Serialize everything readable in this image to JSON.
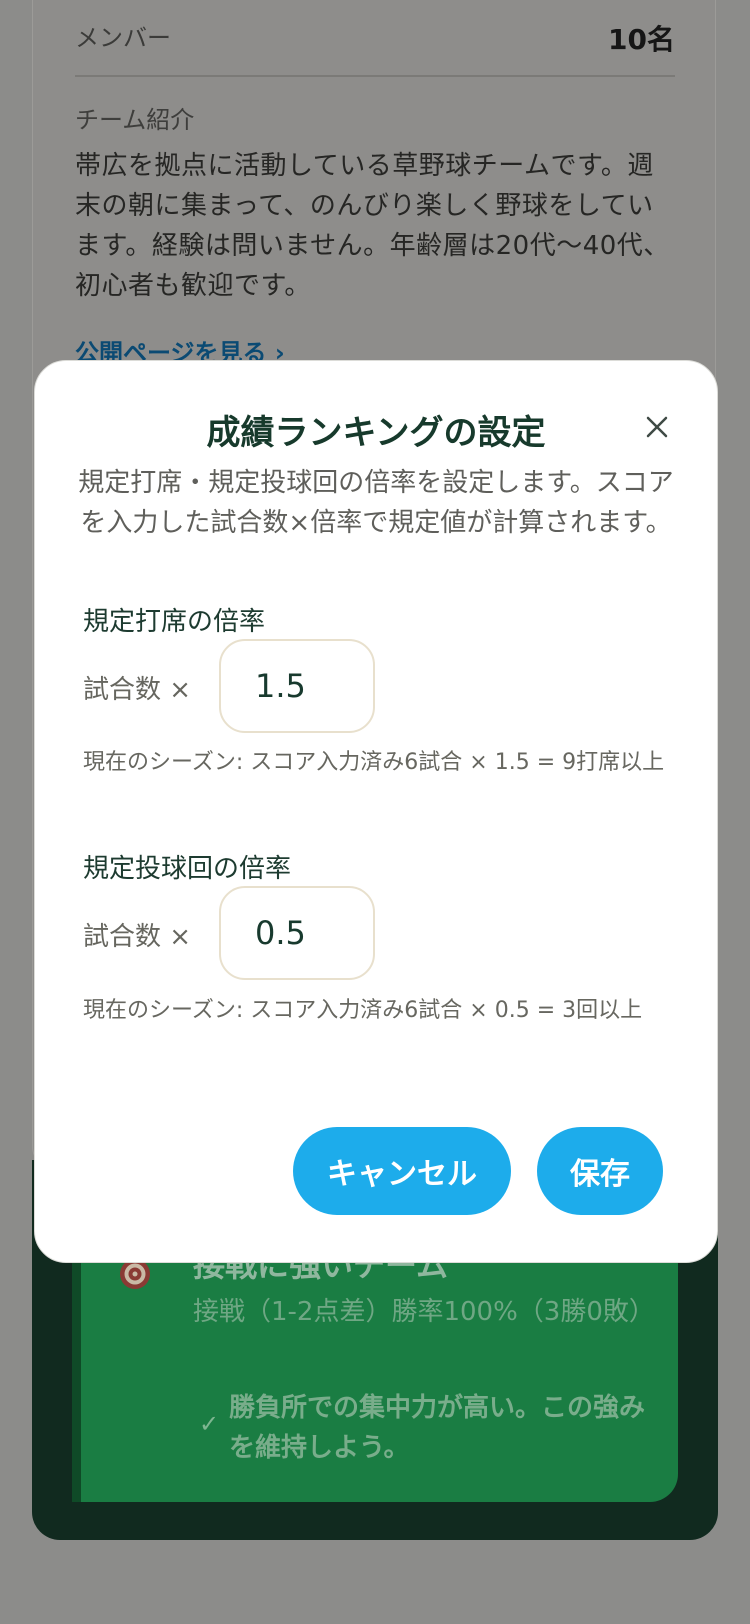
{
  "background": {
    "member_label": "メンバー",
    "member_count": "10名",
    "intro_label": "チーム紹介",
    "intro_text": "帯広を拠点に活動している草野球チームです。週末の朝に集まって、のんびり楽しく野球をしています。経験は問いません。年齢層は20代〜40代、初心者も歓迎です。",
    "public_link": "公開ページを見る ›",
    "card_title": "接戦に強いチーム",
    "card_text": "接戦（1-2点差）勝率100%（3勝0敗）",
    "card_note": "勝負所での集中力が高い。この強みを維持しよう。"
  },
  "modal": {
    "title": "成績ランキングの設定",
    "description": "規定打席・規定投球回の倍率を設定します。スコアを入力した試合数×倍率で規定値が計算されます。",
    "batting": {
      "label": "規定打席の倍率",
      "multiplier_label": "試合数 ×",
      "value": "1.5",
      "current": "現在のシーズン: スコア入力済み6試合 × 1.5 = 9打席以上"
    },
    "pitching": {
      "label": "規定投球回の倍率",
      "multiplier_label": "試合数 ×",
      "value": "0.5",
      "current": "現在のシーズン: スコア入力済み6試合 × 0.5 = 3回以上"
    },
    "cancel_label": "キャンセル",
    "save_label": "保存"
  },
  "icons": {
    "close": "close-icon",
    "target": "target-icon",
    "check": "check-icon"
  },
  "colors": {
    "accent": "#1daceb",
    "title": "#173a2c",
    "card_green": "#1a7d43"
  }
}
